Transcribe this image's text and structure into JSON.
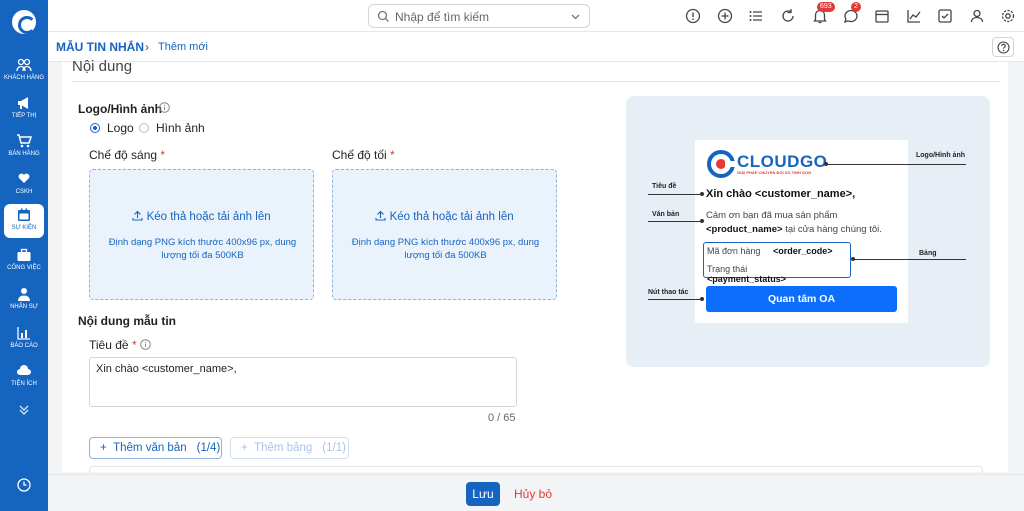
{
  "nav": {
    "items": [
      {
        "label": "Khách hàng"
      },
      {
        "label": "Tiếp thị"
      },
      {
        "label": "Bán hàng"
      },
      {
        "label": "CSKH"
      },
      {
        "label": "Sự kiện"
      },
      {
        "label": "Công việc"
      },
      {
        "label": "Nhân sự"
      },
      {
        "label": "Báo cáo"
      },
      {
        "label": "Tiện ích"
      }
    ]
  },
  "topbar": {
    "search_placeholder": "Nhập để tìm kiếm",
    "notifications_count": "693",
    "messages_count": "2"
  },
  "breadcrumb": {
    "main": "Mẫu tin nhắn",
    "sep": "›",
    "current": "Thêm mới"
  },
  "form": {
    "section_title": "Nội dung",
    "logo_label": "Logo/Hình ảnh",
    "radio_logo": "Logo",
    "radio_image": "Hình ảnh",
    "light_mode": "Chế độ sáng",
    "dark_mode": "Chế độ tối",
    "required_mark": "*",
    "upload_title": "Kéo thả hoặc tải ảnh lên",
    "upload_hint": "Định dạng PNG kích thước 400x96 px, dung lượng tối đa 500KB",
    "content_label": "Nội dung mẫu tin",
    "title_label": "Tiêu đề",
    "title_value": "Xin chào <customer_name>,",
    "counter": "0 / 65",
    "add_text_label": "Thêm văn bản",
    "add_text_count": "(1/4)",
    "add_table_label": "Thêm bảng",
    "add_table_count": "(1/1)"
  },
  "preview": {
    "brand": "CLOUDGO",
    "brand_tagline": "GIẢI PHÁP CHUYỂN ĐỔI SỐ TINH GỌN",
    "title": "Xin chào <customer_name>,",
    "text_before": "Cảm ơn bạn đã mua sản phẩm",
    "text_product": "<product_name>",
    "text_after": "tại cửa hàng chúng tôi.",
    "rows": [
      {
        "key": "Mã đơn hàng",
        "value": "<order_code>"
      },
      {
        "key": "Trạng thái",
        "value": "<payment_status>"
      }
    ],
    "button": "Quan tâm OA",
    "annotations": {
      "logo": "Logo/Hình ảnh",
      "title": "Tiêu đề",
      "text": "Văn bản",
      "table": "Bảng",
      "action": "Nút thao tác"
    }
  },
  "footer": {
    "save": "Lưu",
    "cancel": "Hủy bỏ"
  },
  "colors": {
    "primary": "#1565c0",
    "danger": "#e53935",
    "preview_bg": "#e8eef6"
  }
}
